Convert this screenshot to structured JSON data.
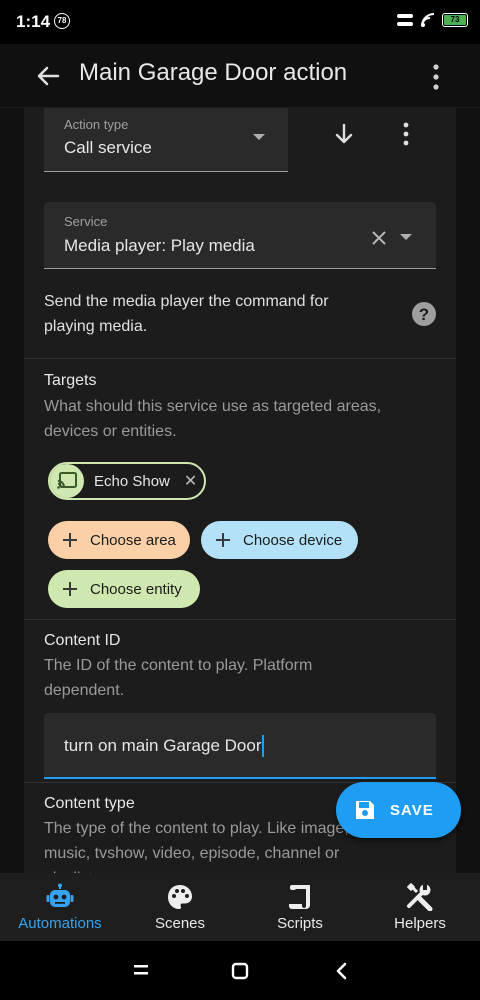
{
  "status": {
    "time": "1:14",
    "badge": "78",
    "battery": "73"
  },
  "app_bar": {
    "title": "Main Garage Door action"
  },
  "action_type": {
    "label": "Action type",
    "value": "Call service"
  },
  "service": {
    "label": "Service",
    "value": "Media player: Play media"
  },
  "service_description": "Send the media player the command for playing media.",
  "targets": {
    "title": "Targets",
    "description": "What should this service use as targeted areas, devices or entities.",
    "selected_entity": "Echo Show",
    "choose_area": "Choose area",
    "choose_device": "Choose device",
    "choose_entity": "Choose entity"
  },
  "content_id": {
    "title": "Content ID",
    "description": "The ID of the content to play. Platform dependent.",
    "value": "turn on main Garage Door"
  },
  "content_type": {
    "title": "Content type",
    "description": "The type of the content to play. Like image, music, tvshow, video, episode, channel or playlist."
  },
  "fab": {
    "label": "SAVE"
  },
  "nav": {
    "automations": "Automations",
    "scenes": "Scenes",
    "scripts": "Scripts",
    "helpers": "Helpers"
  },
  "colors": {
    "accent": "#35a3f0",
    "fab": "#1e9df2",
    "area_chip": "#fbd0a6",
    "device_chip": "#b3e1f7",
    "entity_chip": "#cfe8b0"
  },
  "icons": [
    "back-arrow-icon",
    "more-vert-icon",
    "arrow-down-icon",
    "clear-icon",
    "help-icon",
    "cast-icon",
    "plus-icon",
    "save-icon",
    "robot-icon",
    "palette-icon",
    "script-icon",
    "tools-icon"
  ]
}
